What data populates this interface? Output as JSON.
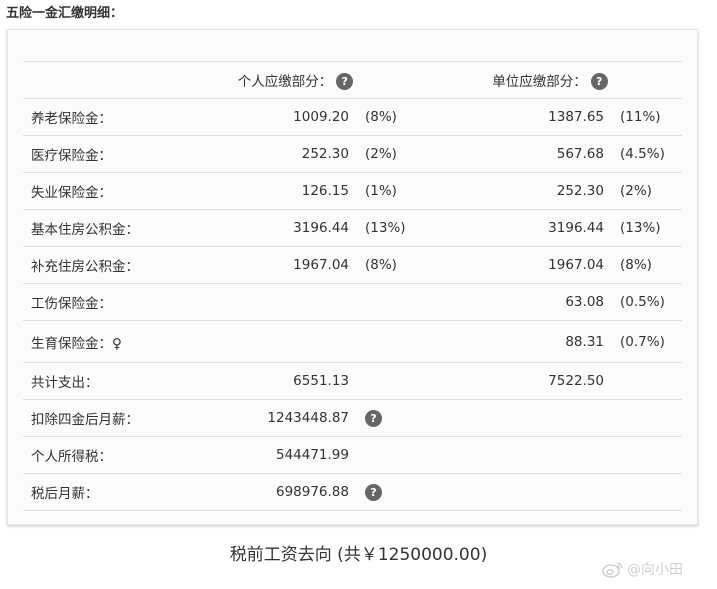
{
  "title": "五险一金汇缴明细：",
  "headers": {
    "personal": "个人应缴部分：",
    "company": "单位应缴部分："
  },
  "help_icon": "?",
  "rows": [
    {
      "label": "养老保险金：",
      "personal": "1009.20",
      "personal_rate": "(8%)",
      "company": "1387.65",
      "company_rate": "(11%)"
    },
    {
      "label": "医疗保险金：",
      "personal": "252.30",
      "personal_rate": "(2%)",
      "company": "567.68",
      "company_rate": "(4.5%)"
    },
    {
      "label": "失业保险金：",
      "personal": "126.15",
      "personal_rate": "(1%)",
      "company": "252.30",
      "company_rate": "(2%)"
    },
    {
      "label": "基本住房公积金：",
      "personal": "3196.44",
      "personal_rate": "(13%)",
      "company": "3196.44",
      "company_rate": "(13%)"
    },
    {
      "label": "补充住房公积金：",
      "personal": "1967.04",
      "personal_rate": "(8%)",
      "company": "1967.04",
      "company_rate": "(8%)"
    },
    {
      "label": "工伤保险金：",
      "personal": "",
      "personal_rate": "",
      "company": "63.08",
      "company_rate": "(0.5%)"
    },
    {
      "label": "生育保险金：♀",
      "personal": "",
      "personal_rate": "",
      "company": "88.31",
      "company_rate": "(0.7%)"
    }
  ],
  "total": {
    "label": "共计支出：",
    "personal": "6551.13",
    "company": "7522.50"
  },
  "net_after_funds": {
    "label": "扣除四金后月薪：",
    "value": "1243448.87"
  },
  "income_tax": {
    "label": "个人所得税：",
    "value": "544471.99"
  },
  "after_tax": {
    "label": "税后月薪：",
    "value": "698976.88"
  },
  "caption": "税前工资去向 (共￥1250000.00)",
  "watermark": "@向小田"
}
